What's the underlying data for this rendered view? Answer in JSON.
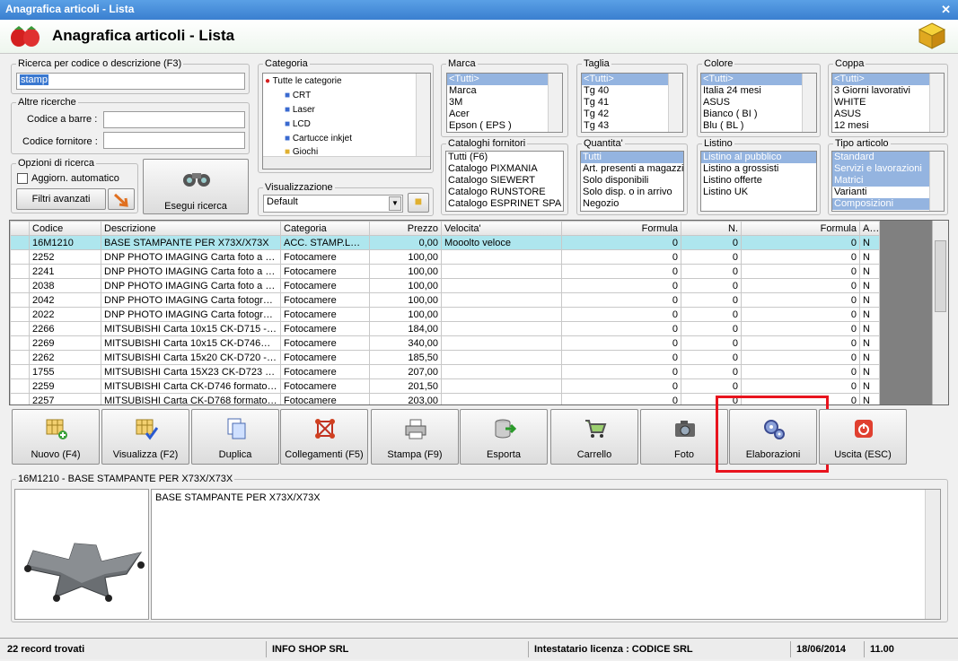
{
  "window": {
    "title": "Anagrafica articoli  - Lista"
  },
  "header": {
    "title": "Anagrafica articoli  - Lista"
  },
  "search": {
    "group_label": "Ricerca per codice o descrizione (F3)",
    "value": "stamp",
    "altre_label": "Altre ricerche",
    "barcode_label": "Codice a barre :",
    "barcode_value": "",
    "supplier_label": "Codice fornitore :",
    "supplier_value": ""
  },
  "options": {
    "group_label": "Opzioni di ricerca",
    "auto_update_label": "Aggiorn. automatico",
    "advanced_filters_label": "Filtri avanzati",
    "run_search_label": "Esegui ricerca"
  },
  "category": {
    "group_label": "Categoria",
    "items": [
      "Tutte le categorie",
      "CRT",
      "Laser",
      "LCD",
      "Cartucce inkjet",
      "Giochi"
    ]
  },
  "view": {
    "group_label": "Visualizzazione",
    "selected": "Default"
  },
  "filters": {
    "marca": {
      "label": "Marca",
      "items": [
        "<Tutti>",
        "Marca",
        "3M",
        "Acer",
        "Epson ( EPS )"
      ]
    },
    "taglia": {
      "label": "Taglia",
      "items": [
        "<Tutti>",
        "Tg 40",
        "Tg 41",
        "Tg 42",
        "Tg 43"
      ]
    },
    "colore": {
      "label": "Colore",
      "items": [
        "<Tutti>",
        "Italia 24 mesi",
        "ASUS",
        "Bianco ( BI )",
        "Blu ( BL )"
      ]
    },
    "coppa": {
      "label": "Coppa",
      "items": [
        "<Tutti>",
        "3 Giorni lavorativi",
        "WHITE",
        "ASUS",
        "12 mesi"
      ]
    },
    "cataloghi": {
      "label": "Cataloghi fornitori",
      "items": [
        "Tutti (F6)",
        "Catalogo PIXMANIA",
        "Catalogo SIEWERT",
        "Catalogo RUNSTORE",
        "Catalogo ESPRINET SPA"
      ]
    },
    "quantita": {
      "label": "Quantita'",
      "items": [
        "Tutti",
        "Art. presenti a magazzino",
        "Solo disponibili",
        "Solo disp. o in arrivo",
        "Negozio"
      ]
    },
    "listino": {
      "label": "Listino",
      "items": [
        "Listino al pubblico",
        "Listino a grossisti",
        "Listino offerte",
        "Listino UK"
      ]
    },
    "tipo": {
      "label": "Tipo articolo",
      "items": [
        "Standard",
        "Servizi e lavorazioni",
        "Matrici",
        "Varianti",
        "Composizioni"
      ]
    }
  },
  "grid": {
    "columns": [
      "Codice",
      "Descrizione",
      "Categoria",
      "Prezzo",
      "Velocita'",
      "Formula",
      "N.",
      "Formula",
      "A..."
    ],
    "rows": [
      [
        "16M1210",
        "BASE STAMPANTE PER X73X/X73X",
        "ACC. STAMP.LASER",
        "0,00",
        "Mooolto veloce",
        "0",
        "0",
        "0",
        "N"
      ],
      [
        "2252",
        "DNP PHOTO IMAGING Carta foto a sublimazione",
        "Fotocamere",
        "100,00",
        "",
        "0",
        "0",
        "0",
        "N"
      ],
      [
        "2241",
        "DNP PHOTO IMAGING Carta foto a sublimazione",
        "Fotocamere",
        "100,00",
        "",
        "0",
        "0",
        "0",
        "N"
      ],
      [
        "2038",
        "DNP PHOTO IMAGING Carta foto a sublimazione",
        "Fotocamere",
        "100,00",
        "",
        "0",
        "0",
        "0",
        "N"
      ],
      [
        "2042",
        "DNP PHOTO IMAGING Carta fotografica",
        "Fotocamere",
        "100,00",
        "",
        "0",
        "0",
        "0",
        "N"
      ],
      [
        "2022",
        "DNP PHOTO IMAGING Carta fotografica",
        "Fotocamere",
        "100,00",
        "",
        "0",
        "0",
        "0",
        "N"
      ],
      [
        "2266",
        "MITSUBISHI Carta 10x15 CK-D715 - 8...",
        "Fotocamere",
        "184,00",
        "",
        "0",
        "0",
        "0",
        "N"
      ],
      [
        "2269",
        "MITSUBISHI Carta 10x15 CK-D746U -...",
        "Fotocamere",
        "340,00",
        "",
        "0",
        "0",
        "0",
        "N"
      ],
      [
        "2262",
        "MITSUBISHI Carta 15x20 CK-D720 - 4...",
        "Fotocamere",
        "185,50",
        "",
        "0",
        "0",
        "0",
        "N"
      ],
      [
        "1755",
        "MITSUBISHI Carta 15X23 CK-D723 - 4...",
        "Fotocamere",
        "207,00",
        "",
        "0",
        "0",
        "0",
        "N"
      ],
      [
        "2259",
        "MITSUBISHI Carta CK-D746 formato ...",
        "Fotocamere",
        "201,50",
        "",
        "0",
        "0",
        "0",
        "N"
      ],
      [
        "2257",
        "MITSUBISHI Carta CK-D768 formato ...",
        "Fotocamere",
        "203,00",
        "",
        "0",
        "0",
        "0",
        "N"
      ]
    ]
  },
  "toolbar": {
    "nuovo": "Nuovo (F4)",
    "visualizza": "Visualizza (F2)",
    "duplica": "Duplica",
    "collegamenti": "Collegamenti (F5)",
    "stampa": "Stampa (F9)",
    "esporta": "Esporta",
    "carrello": "Carrello",
    "foto": "Foto",
    "elaborazioni": "Elaborazioni",
    "uscita": "Uscita (ESC)"
  },
  "detail": {
    "group_label": "16M1210 - BASE STAMPANTE PER X73X/X73X",
    "text": "BASE STAMPANTE PER X73X/X73X"
  },
  "status": {
    "records": "22 record trovati",
    "company": "INFO SHOP SRL",
    "license": "Intestatario licenza : CODICE SRL",
    "date": "18/06/2014",
    "time": "11.00"
  },
  "colors": {
    "highlight": "#e8141e",
    "selection": "#aee6ee",
    "list_selection": "#94b4e0"
  }
}
